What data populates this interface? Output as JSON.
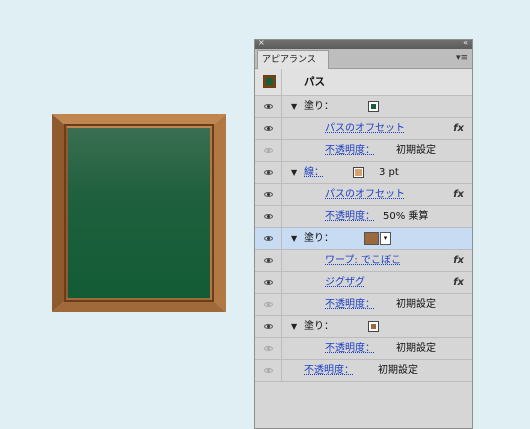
{
  "panel": {
    "close_glyph": "×",
    "collapse_glyph": "«",
    "tab_label": "アピアランス",
    "menu_glyph": "▾≡",
    "header_label": "パス",
    "rows": {
      "fill1_label": "塗り：",
      "offset1_effect": "パスのオフセット",
      "opacity1_label": "不透明度：",
      "opacity1_value": "初期設定",
      "stroke_label": "線：",
      "stroke_value": "3 pt",
      "offset2_effect": "パスのオフセット",
      "opacity2_label": "不透明度：",
      "opacity2_value": "50% 乗算",
      "fill2_label": "塗り：",
      "warp_effect": "ワープ: でこぼこ",
      "zigzag_effect": "ジグザグ",
      "opacity3_label": "不透明度：",
      "opacity3_value": "初期設定",
      "fill3_label": "塗り：",
      "opacity4_label": "不透明度：",
      "opacity4_value": "初期設定",
      "opacity5_label": "不透明度：",
      "opacity5_value": "初期設定"
    },
    "fx_label": "fx",
    "dropdown_glyph": "▾"
  },
  "colors": {
    "board_green": "#1b5d3a",
    "frame_brown": "#9b6a3c",
    "stroke_tan": "#d7a26e",
    "background": "#dfeff4"
  }
}
